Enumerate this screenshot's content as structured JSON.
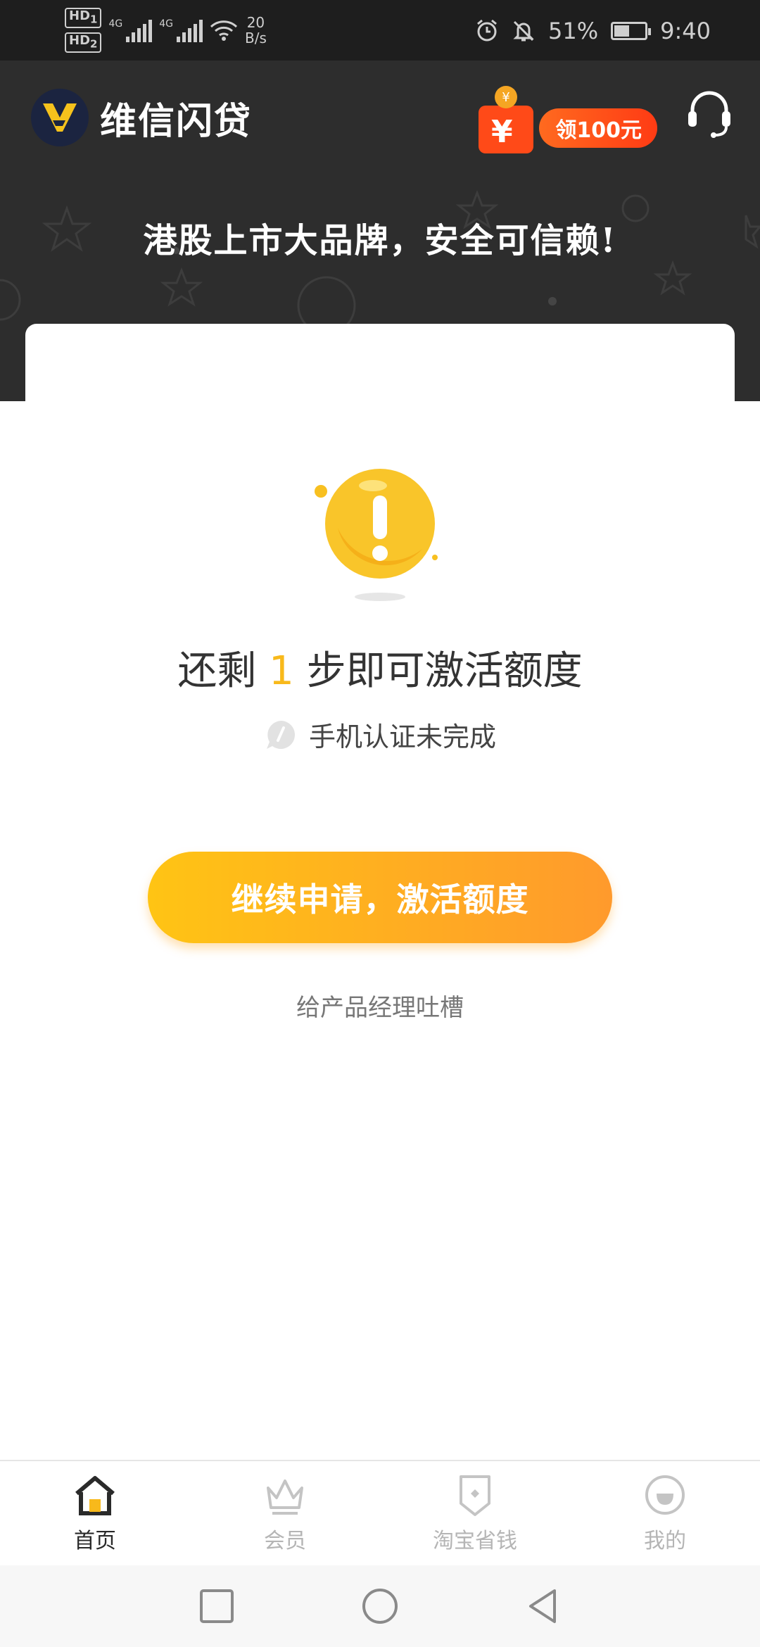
{
  "status_bar": {
    "hd1": "HD",
    "hd1_sub": "1",
    "hd2": "HD",
    "hd2_sub": "2",
    "net1": "4G",
    "net2": "4G",
    "speed_value": "20",
    "speed_unit": "B/s",
    "battery_percent": "51%",
    "battery_level": 0.51,
    "time": "9:40"
  },
  "header": {
    "app_name": "维信闪贷",
    "promo_label": "领100元",
    "promo_symbol": "¥",
    "slogan": "港股上市大品牌，安全可信赖!"
  },
  "main": {
    "steps_prefix": "还剩 ",
    "steps_number": "1",
    "steps_suffix": " 步即可激活额度",
    "status_text": "手机认证未完成",
    "cta_label": "继续申请，激活额度",
    "feedback_link": "给产品经理吐槽"
  },
  "tabs": [
    {
      "label": "首页",
      "icon": "home-icon",
      "active": true
    },
    {
      "label": "会员",
      "icon": "crown-icon",
      "active": false
    },
    {
      "label": "淘宝省钱",
      "icon": "badge-icon",
      "active": false
    },
    {
      "label": "我的",
      "icon": "profile-icon",
      "active": false
    }
  ],
  "colors": {
    "accent": "#f8b91b",
    "cta_start": "#ffc414",
    "cta_end": "#ff9a2c",
    "header_bg": "#2d2d2d",
    "promo": "#ff4a18"
  }
}
